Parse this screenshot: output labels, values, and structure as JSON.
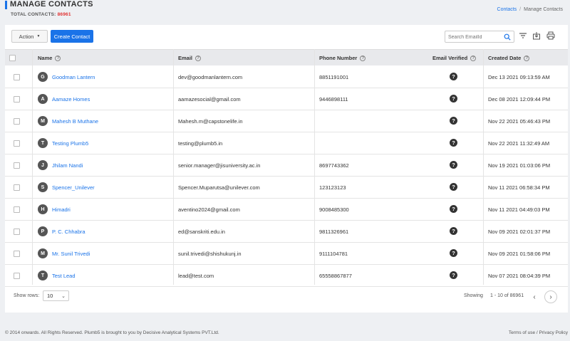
{
  "header": {
    "title": "MANAGE CONTACTS",
    "total_label": "TOTAL CONTACTS:",
    "total_count": "86961",
    "breadcrumb": {
      "link": "Contacts",
      "separator": "/",
      "current": "Manage Contacts"
    }
  },
  "toolbar": {
    "action_label": "Action",
    "create_label": "Create Contact",
    "search_placeholder": "Search EmailId"
  },
  "table": {
    "columns": {
      "name": "Name",
      "email": "Email",
      "phone": "Phone Number",
      "verified": "Email Verified",
      "created": "Created Date"
    },
    "rows": [
      {
        "initial": "G",
        "name": "Goodman Lantern",
        "email": "dev@goodmanlantern.com",
        "phone": "8851191001",
        "verified": "?",
        "created": "Dec 13 2021 09:13:59 AM"
      },
      {
        "initial": "A",
        "name": "Aamaze Homes",
        "email": "aamazesocial@gmail.com",
        "phone": "9446898111",
        "verified": "?",
        "created": "Dec 08 2021 12:09:44 PM"
      },
      {
        "initial": "M",
        "name": "Mahesh B Muthane",
        "email": "Mahesh.m@capstonelife.in",
        "phone": "",
        "verified": "?",
        "created": "Nov 22 2021 05:46:43 PM"
      },
      {
        "initial": "T",
        "name": "Testing Plumb5",
        "email": "testing@plumb5.in",
        "phone": "",
        "verified": "?",
        "created": "Nov 22 2021 11:32:49 AM"
      },
      {
        "initial": "J",
        "name": "Jhilam Nandi",
        "email": "senior.manager@jisuniversity.ac.in",
        "phone": "8697743362",
        "verified": "?",
        "created": "Nov 19 2021 01:03:06 PM"
      },
      {
        "initial": "S",
        "name": "Spencer_Unilever",
        "email": "Spencer.Muparutsa@unilever.com",
        "phone": "123123123",
        "verified": "?",
        "created": "Nov 11 2021 06:58:34 PM"
      },
      {
        "initial": "H",
        "name": "Himadri",
        "email": "aventino2024@gmail.com",
        "phone": "9008485300",
        "verified": "?",
        "created": "Nov 11 2021 04:49:03 PM"
      },
      {
        "initial": "P",
        "name": "P. C. Chhabra",
        "email": "ed@sanskriti.edu.in",
        "phone": "9811326961",
        "verified": "?",
        "created": "Nov 09 2021 02:01:37 PM"
      },
      {
        "initial": "M",
        "name": "Mr. Sunil Trivedi",
        "email": "sunil.trivedi@shishukunj.in",
        "phone": "9111104781",
        "verified": "?",
        "created": "Nov 09 2021 01:58:06 PM"
      },
      {
        "initial": "T",
        "name": "Test Lead",
        "email": "lead@test.com",
        "phone": "65558867877",
        "verified": "?",
        "created": "Nov 07 2021 08:04:39 PM"
      }
    ]
  },
  "pager": {
    "show_rows_label": "Show rows:",
    "rows_value": "10",
    "showing_label": "Showing",
    "range": "1 - 10 of 86961"
  },
  "footer": {
    "copyright": "© 2014 onwards. All Rights Reserved. Plumb5 is brought to you by Decisive Analytical Systems PVT.Ltd.",
    "links": "Terms of use / Privacy Policy"
  },
  "colors": {
    "accent": "#1a73e8",
    "count": "#e03030"
  },
  "icons": [
    "search-icon",
    "filter-icon",
    "export-icon",
    "print-icon",
    "help-icon",
    "chevron-down-icon",
    "chevron-left-icon",
    "chevron-right-icon"
  ]
}
